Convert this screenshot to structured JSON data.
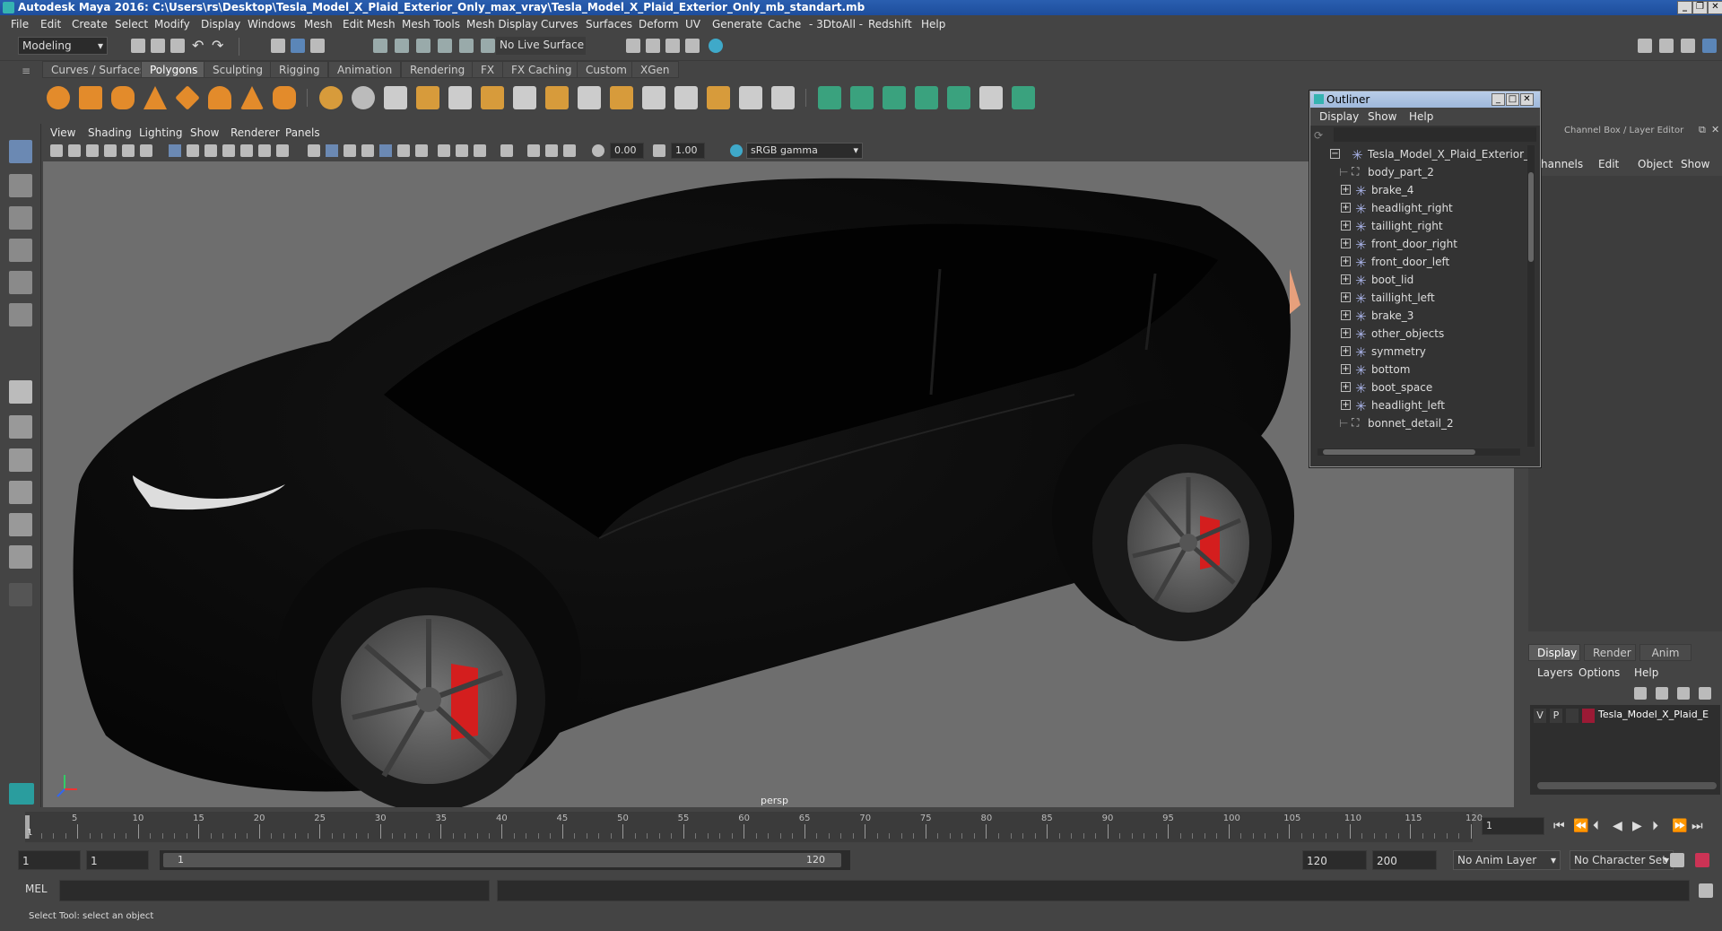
{
  "titlebar": {
    "title": "Autodesk Maya 2016: C:\\Users\\rs\\Desktop\\Tesla_Model_X_Plaid_Exterior_Only_max_vray\\Tesla_Model_X_Plaid_Exterior_Only_mb_standart.mb"
  },
  "menu": [
    "File",
    "Edit",
    "Create",
    "Select",
    "Modify",
    "Display",
    "Windows",
    "Mesh",
    "Edit Mesh",
    "Mesh Tools",
    "Mesh Display",
    "Curves",
    "Surfaces",
    "Deform",
    "UV",
    "Generate",
    "Cache",
    "- 3DtoAll -",
    "Redshift",
    "Help"
  ],
  "status": {
    "mode": "Modeling",
    "live_surface": "No Live Surface"
  },
  "shelf_tabs": [
    "Curves / Surfaces",
    "Polygons",
    "Sculpting",
    "Rigging",
    "Animation",
    "Rendering",
    "FX",
    "FX Caching",
    "Custom",
    "XGen"
  ],
  "shelf_active": "Polygons",
  "viewport": {
    "menu": [
      "View",
      "Shading",
      "Lighting",
      "Show",
      "Renderer",
      "Panels"
    ],
    "exposure": "0.00",
    "gamma": "1.00",
    "colorspace": "sRGB gamma",
    "camera_label": "persp"
  },
  "outliner": {
    "title": "Outliner",
    "menu": [
      "Display",
      "Show",
      "Help"
    ],
    "root": "Tesla_Model_X_Plaid_Exterior_Onl",
    "items": [
      {
        "label": "body_part_2",
        "kind": "mesh"
      },
      {
        "label": "brake_4",
        "kind": "group"
      },
      {
        "label": "headlight_right",
        "kind": "group"
      },
      {
        "label": "taillight_right",
        "kind": "group"
      },
      {
        "label": "front_door_right",
        "kind": "group"
      },
      {
        "label": "front_door_left",
        "kind": "group"
      },
      {
        "label": "boot_lid",
        "kind": "group"
      },
      {
        "label": "taillight_left",
        "kind": "group"
      },
      {
        "label": "brake_3",
        "kind": "group"
      },
      {
        "label": "other_objects",
        "kind": "group"
      },
      {
        "label": "symmetry",
        "kind": "group"
      },
      {
        "label": "bottom",
        "kind": "group"
      },
      {
        "label": "boot_space",
        "kind": "group"
      },
      {
        "label": "headlight_left",
        "kind": "group"
      },
      {
        "label": "bonnet_detail_2",
        "kind": "mesh"
      }
    ]
  },
  "channel_box": {
    "title": "Channel Box / Layer Editor",
    "menu": [
      "hannels",
      "Edit",
      "Object",
      "Show"
    ],
    "tabs": [
      "Display",
      "Render",
      "Anim"
    ],
    "layer_menu": [
      "Layers",
      "Options",
      "Help"
    ],
    "layer": {
      "v": "V",
      "p": "P",
      "name": "Tesla_Model_X_Plaid_E",
      "color": "#9b1a35"
    }
  },
  "timeline": {
    "ticks": [
      "5",
      "10",
      "15",
      "20",
      "25",
      "30",
      "35",
      "40",
      "45",
      "50",
      "55",
      "60",
      "65",
      "70",
      "75",
      "80",
      "85",
      "90",
      "95",
      "100",
      "105",
      "110",
      "115",
      "120"
    ],
    "current_frame": "1",
    "frame_field": "1"
  },
  "range": {
    "start": "1",
    "start2": "1",
    "slider_start": "1",
    "slider_end": "120",
    "end": "120",
    "end2": "200",
    "anim_layer": "No Anim Layer",
    "char_set": "No Character Set"
  },
  "cmd": {
    "label": "MEL"
  },
  "help": {
    "text": "Select Tool: select an object"
  }
}
